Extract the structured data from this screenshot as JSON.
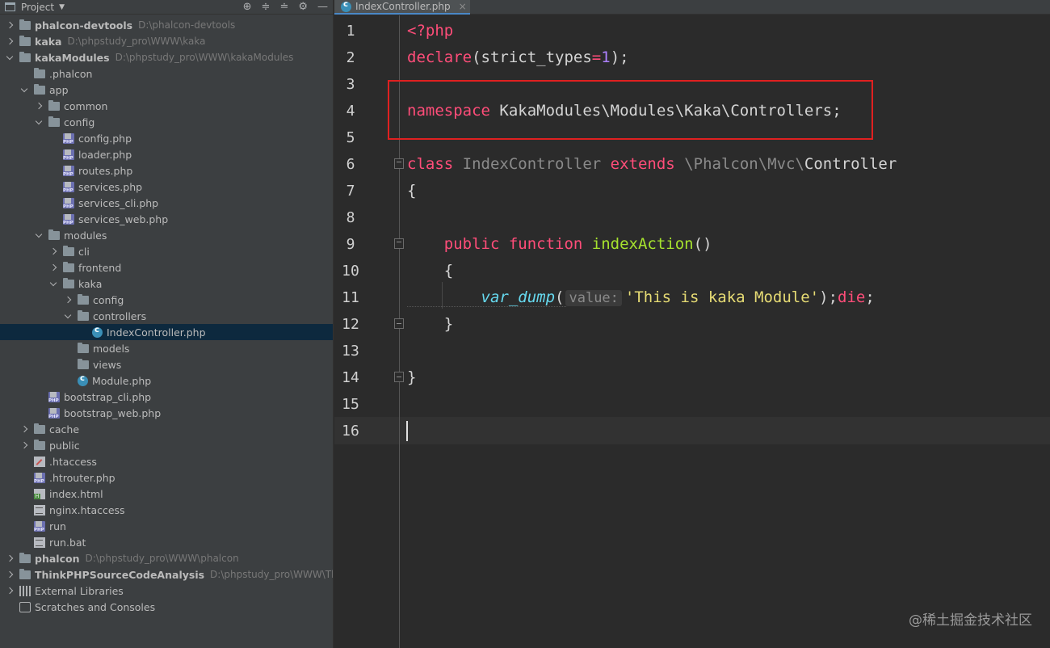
{
  "project_panel": {
    "title": "Project",
    "tree": [
      {
        "label": "phalcon-devtools",
        "path": "D:\\phalcon-devtools",
        "icon": "folder-icon",
        "expanded": false
      },
      {
        "label": "kaka",
        "path": "D:\\phpstudy_pro\\WWW\\kaka",
        "icon": "folder-icon",
        "expanded": false
      },
      {
        "label": "kakaModules",
        "path": "D:\\phpstudy_pro\\WWW\\kakaModules",
        "icon": "folder-icon",
        "expanded": true
      },
      {
        "label": ".phalcon",
        "icon": "folder-icon"
      },
      {
        "label": "app",
        "icon": "folder-icon",
        "expanded": true
      },
      {
        "label": "common",
        "icon": "folder-icon",
        "expanded": false
      },
      {
        "label": "config",
        "icon": "folder-icon",
        "expanded": true
      },
      {
        "label": "config.php",
        "icon": "php-file-icon"
      },
      {
        "label": "loader.php",
        "icon": "php-file-icon"
      },
      {
        "label": "routes.php",
        "icon": "php-file-icon"
      },
      {
        "label": "services.php",
        "icon": "php-file-icon"
      },
      {
        "label": "services_cli.php",
        "icon": "php-file-icon"
      },
      {
        "label": "services_web.php",
        "icon": "php-file-icon"
      },
      {
        "label": "modules",
        "icon": "folder-icon",
        "expanded": true
      },
      {
        "label": "cli",
        "icon": "folder-icon",
        "expanded": false
      },
      {
        "label": "frontend",
        "icon": "folder-icon",
        "expanded": false
      },
      {
        "label": "kaka",
        "icon": "folder-icon",
        "expanded": true
      },
      {
        "label": "config",
        "icon": "folder-icon",
        "expanded": false
      },
      {
        "label": "controllers",
        "icon": "folder-icon",
        "expanded": true
      },
      {
        "label": "IndexController.php",
        "icon": "class-icon",
        "selected": true
      },
      {
        "label": "models",
        "icon": "folder-icon"
      },
      {
        "label": "views",
        "icon": "folder-icon"
      },
      {
        "label": "Module.php",
        "icon": "class-icon"
      },
      {
        "label": "bootstrap_cli.php",
        "icon": "php-file-icon"
      },
      {
        "label": "bootstrap_web.php",
        "icon": "php-file-icon"
      },
      {
        "label": "cache",
        "icon": "folder-icon",
        "expanded": false
      },
      {
        "label": "public",
        "icon": "folder-icon",
        "expanded": false
      },
      {
        "label": ".htaccess",
        "icon": "htaccess-icon"
      },
      {
        "label": ".htrouter.php",
        "icon": "php-file-icon"
      },
      {
        "label": "index.html",
        "icon": "html-file-icon"
      },
      {
        "label": "nginx.htaccess",
        "icon": "text-file-icon"
      },
      {
        "label": "run",
        "icon": "php-file-icon"
      },
      {
        "label": "run.bat",
        "icon": "text-file-icon"
      },
      {
        "label": "phalcon",
        "path": "D:\\phpstudy_pro\\WWW\\phalcon",
        "icon": "folder-icon",
        "expanded": false
      },
      {
        "label": "ThinkPHPSourceCodeAnalysis",
        "path": "D:\\phpstudy_pro\\WWW\\ThinkP",
        "icon": "folder-icon",
        "expanded": false
      },
      {
        "label": "External Libraries",
        "icon": "libraries-icon",
        "expanded": false
      },
      {
        "label": "Scratches and Consoles",
        "icon": "scratches-icon"
      }
    ]
  },
  "editor": {
    "tab_label": "IndexController.php",
    "tab_close": "×",
    "line_numbers": [
      "1",
      "2",
      "3",
      "4",
      "5",
      "6",
      "7",
      "8",
      "9",
      "10",
      "11",
      "12",
      "13",
      "14",
      "15",
      "16"
    ],
    "code": {
      "l1_tag": "<?php",
      "l2_kw": "declare",
      "l2_a": "(strict_types",
      "l2_eq": "=",
      "l2_num": "1",
      "l2_b": ");",
      "l4_kw": "namespace",
      "l4_rest": " KakaModules\\Modules\\Kaka\\Controllers;",
      "l6_kw": "class",
      "l6_name": " IndexController ",
      "l6_kw2": "extends",
      "l6_ns": " \\Phalcon\\Mvc\\",
      "l6_base": "Controller",
      "l7": "{",
      "l9_kw": "    public",
      "l9_kw2": " function",
      "l9_fn": " indexAction",
      "l9_paren": "()",
      "l10": "    {",
      "l11_indent": "        ",
      "l11_call": "var_dump",
      "l11_paren": "(",
      "l11_hint": "value:",
      "l11_str": "'This is kaka Module'",
      "l11_close": ");",
      "l11_die": "die",
      "l11_semi": ";",
      "l12": "    }",
      "l14": "}"
    },
    "highlight_color": "#e02020"
  },
  "watermark": "@稀土掘金技术社区"
}
